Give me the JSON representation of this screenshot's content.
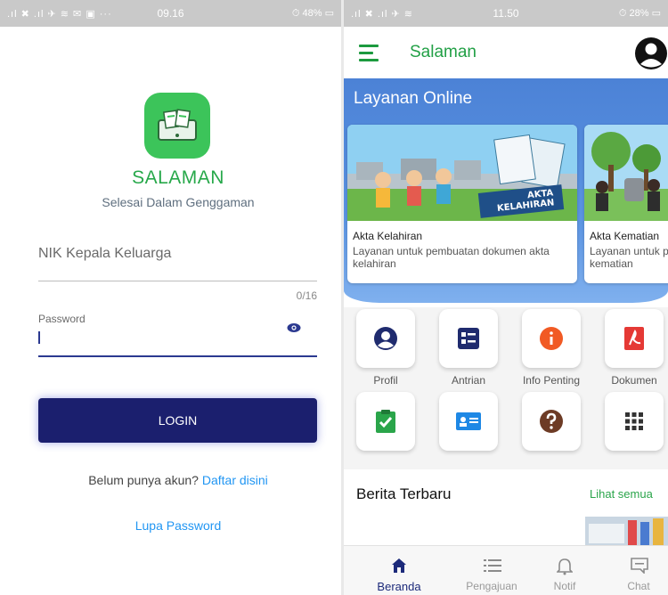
{
  "left_status": {
    "signal": ".ıl ✖ .ıl ✈ ≋ ✉ ▣ ···",
    "time": "09.16",
    "battery": "⏱ 48% ▭"
  },
  "right_status": {
    "signal": ".ıl ✖ .ıl ✈ ≋",
    "time": "11.50",
    "battery": "⏱ 28% ▭"
  },
  "login": {
    "app_name": "SALAMAN",
    "tagline": "Selesai Dalam Genggaman",
    "nik_placeholder": "NIK Kepala Keluarga",
    "nik_counter": "0/16",
    "password_label": "Password",
    "login_label": "LOGIN",
    "register_prompt": "Belum punya akun?",
    "register_link": "Daftar disini",
    "forgot_password": "Lupa Password"
  },
  "home": {
    "brand": "Salaman",
    "section_title": "Layanan Online",
    "cards": [
      {
        "title": "Akta Kelahiran",
        "desc": "Layanan untuk pembuatan dokumen akta kelahiran",
        "image_badge": "AKTA KELAHIRAN"
      },
      {
        "title": "Akta Kematian",
        "desc": "Layanan untuk pembuatan dokumen akta kematian"
      }
    ],
    "menu": [
      {
        "label": "Profil",
        "icon": "account-circle-icon",
        "color": "#1f2b6e"
      },
      {
        "label": "Antrian",
        "icon": "queue-list-icon",
        "color": "#1f2b6e"
      },
      {
        "label": "Info Penting",
        "icon": "info-icon",
        "color": "#f15a24"
      },
      {
        "label": "Dokumen",
        "icon": "pdf-icon",
        "color": "#e53935"
      },
      {
        "label": "",
        "icon": "clipboard-check-icon",
        "color": "#2aa54a"
      },
      {
        "label": "",
        "icon": "id-card-icon",
        "color": "#1e88e5"
      },
      {
        "label": "",
        "icon": "help-icon",
        "color": "#6d3b25"
      },
      {
        "label": "",
        "icon": "grid-icon",
        "color": "#333333"
      }
    ],
    "news_title": "Berita Terbaru",
    "news_more": "Lihat semua",
    "nav": [
      {
        "label": "Beranda",
        "icon": "home-icon",
        "active": true
      },
      {
        "label": "Pengajuan",
        "icon": "list-icon",
        "active": false
      },
      {
        "label": "Notif",
        "icon": "bell-icon",
        "active": false
      },
      {
        "label": "Chat",
        "icon": "chat-icon",
        "active": false
      }
    ]
  },
  "colors": {
    "green": "#22a046",
    "navy": "#1b1f6e",
    "blue_link": "#2196f3",
    "hero_blue": "#4c82d6"
  }
}
